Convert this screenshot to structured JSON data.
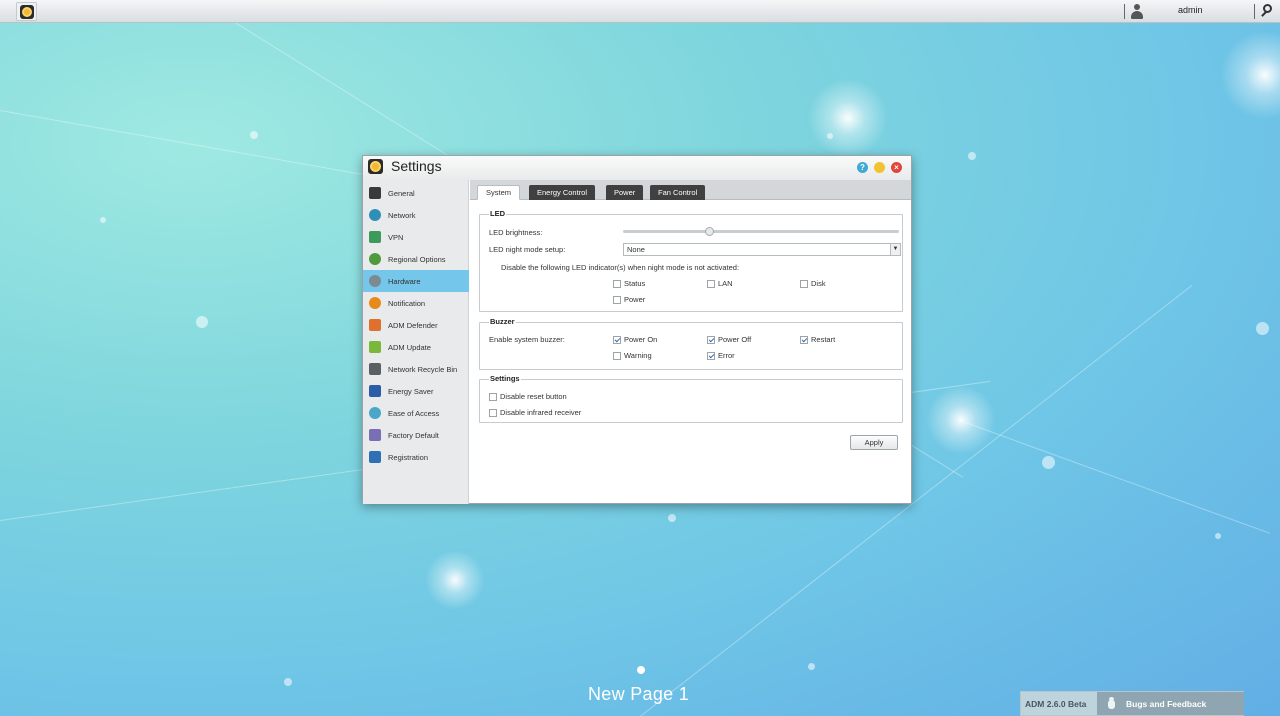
{
  "topbar": {
    "username": "admin"
  },
  "window": {
    "title": "Settings",
    "help_symbol": "?",
    "close_symbol": "×"
  },
  "sidebar": {
    "items": [
      {
        "label": "General",
        "icon": "general-icon"
      },
      {
        "label": "Network",
        "icon": "globe-icon"
      },
      {
        "label": "VPN",
        "icon": "vpn-icon"
      },
      {
        "label": "Regional Options",
        "icon": "regional-options-icon"
      },
      {
        "label": "Hardware",
        "icon": "hardware-icon",
        "active": true
      },
      {
        "label": "Notification",
        "icon": "notification-icon"
      },
      {
        "label": "ADM Defender",
        "icon": "defender-icon"
      },
      {
        "label": "ADM Update",
        "icon": "update-icon"
      },
      {
        "label": "Network Recycle Bin",
        "icon": "recycle-bin-icon"
      },
      {
        "label": "Energy Saver",
        "icon": "energy-saver-icon"
      },
      {
        "label": "Ease of Access",
        "icon": "cloud-icon"
      },
      {
        "label": "Factory Default",
        "icon": "undo-icon"
      },
      {
        "label": "Registration",
        "icon": "registration-icon"
      }
    ]
  },
  "tabs": [
    {
      "label": "System",
      "active": true
    },
    {
      "label": "Energy Control"
    },
    {
      "label": "Power"
    },
    {
      "label": "Fan Control"
    }
  ],
  "led": {
    "legend": "LED",
    "brightness_label": "LED brightness:",
    "brightness_value": 0.31,
    "night_mode_label": "LED night mode setup:",
    "night_mode_value": "None",
    "disable_text": "Disable the following LED indicator(s) when night mode is not activated:",
    "indicators": {
      "status": {
        "label": "Status",
        "checked": false
      },
      "lan": {
        "label": "LAN",
        "checked": false
      },
      "disk": {
        "label": "Disk",
        "checked": false
      },
      "power": {
        "label": "Power",
        "checked": false
      }
    }
  },
  "buzzer": {
    "legend": "Buzzer",
    "enable_label": "Enable system buzzer:",
    "options": {
      "power_on": {
        "label": "Power On",
        "checked": true
      },
      "power_off": {
        "label": "Power Off",
        "checked": true
      },
      "restart": {
        "label": "Restart",
        "checked": true
      },
      "warning": {
        "label": "Warning",
        "checked": false
      },
      "error": {
        "label": "Error",
        "checked": true
      }
    }
  },
  "settings": {
    "legend": "Settings",
    "disable_reset": {
      "label": "Disable reset button",
      "checked": false
    },
    "disable_infrared": {
      "label": "Disable infrared receiver",
      "checked": false
    }
  },
  "apply_label": "Apply",
  "desktop": {
    "page_label": "New Page 1"
  },
  "footer": {
    "version": "ADM 2.6.0 Beta",
    "bugs_label": "Bugs and Feedback"
  }
}
